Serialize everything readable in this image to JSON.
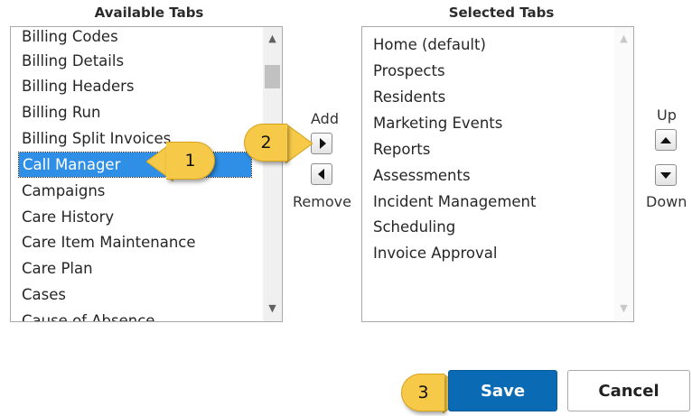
{
  "available": {
    "heading": "Available Tabs",
    "items": [
      "Billing Codes",
      "Billing Details",
      "Billing Headers",
      "Billing Run",
      "Billing Split Invoices",
      "Call Manager",
      "Campaigns",
      "Care History",
      "Care Item Maintenance",
      "Care Plan",
      "Cases",
      "Cause of Absence"
    ],
    "selected_item": "Call Manager"
  },
  "selected": {
    "heading": "Selected Tabs",
    "items": [
      "Home (default)",
      "Prospects",
      "Residents",
      "Marketing Events",
      "Reports",
      "Assessments",
      "Incident Management",
      "Scheduling",
      "Invoice Approval"
    ]
  },
  "transfer": {
    "add_label": "Add",
    "remove_label": "Remove"
  },
  "order": {
    "up_label": "Up",
    "down_label": "Down"
  },
  "callouts": {
    "one": "1",
    "two": "2",
    "three": "3"
  },
  "actions": {
    "save_label": "Save",
    "cancel_label": "Cancel"
  },
  "colors": {
    "selection": "#2f8fe6",
    "save": "#0a6bb4",
    "callout": "#f7c948"
  }
}
